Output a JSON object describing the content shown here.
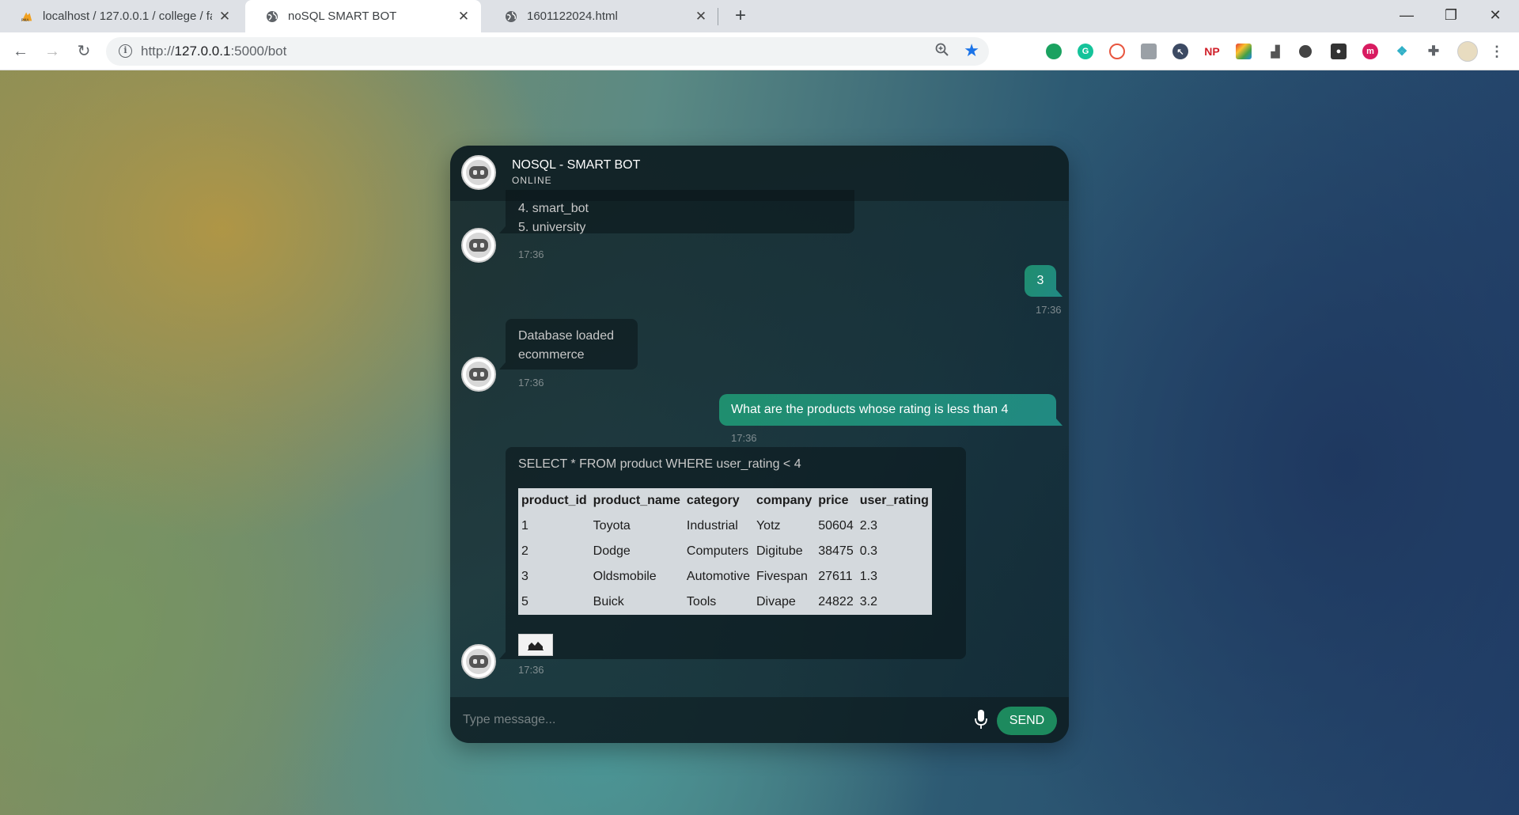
{
  "browser": {
    "tabs": [
      {
        "title": "localhost / 127.0.0.1 / college / fa",
        "icon": "phpmyadmin-icon"
      },
      {
        "title": "noSQL SMART BOT",
        "icon": "globe-icon"
      },
      {
        "title": "1601122024.html",
        "icon": "globe-icon"
      }
    ],
    "url_prefix": "http://",
    "url_host": "127.0.0.1",
    "url_path": ":5000/bot",
    "extension_icons": [
      "chat-bubble-icon",
      "grammarly-icon",
      "swirl-icon",
      "image-icon",
      "cursor-icon",
      "np-icon",
      "colorful-icon",
      "chart-icon",
      "circle-icon",
      "location-icon",
      "infinity-icon",
      "diamond-icon",
      "puzzle-icon",
      "profile-icon"
    ]
  },
  "chat": {
    "title": "NOSQL - SMART BOT",
    "status": "ONLINE",
    "messages": [
      {
        "from": "bot",
        "lines": [
          "4. smart_bot",
          "5. university"
        ],
        "time": "17:36"
      },
      {
        "from": "user",
        "text": "3",
        "time": "17:36"
      },
      {
        "from": "bot",
        "lines": [
          "Database loaded",
          "ecommerce"
        ],
        "time": "17:36"
      },
      {
        "from": "user",
        "text": "What are the products whose rating is less than 4",
        "time": "17:36"
      },
      {
        "from": "bot",
        "query": "SELECT * FROM product WHERE user_rating < 4",
        "time": "17:36"
      }
    ],
    "table": {
      "headers": [
        "product_id",
        "product_name",
        "category",
        "company",
        "price",
        "user_rating"
      ],
      "rows": [
        [
          "1",
          "Toyota",
          "Industrial",
          "Yotz",
          "50604",
          "2.3"
        ],
        [
          "2",
          "Dodge",
          "Computers",
          "Digitube",
          "38475",
          "0.3"
        ],
        [
          "3",
          "Oldsmobile",
          "Automotive",
          "Fivespan",
          "27611",
          "1.3"
        ],
        [
          "5",
          "Buick",
          "Tools",
          "Divape",
          "24822",
          "3.2"
        ]
      ]
    },
    "input_placeholder": "Type message...",
    "send_label": "SEND"
  }
}
